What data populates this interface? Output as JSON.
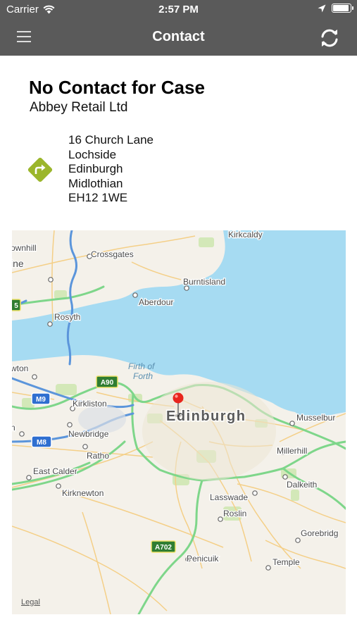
{
  "status": {
    "carrier": "Carrier",
    "time": "2:57 PM"
  },
  "nav": {
    "title": "Contact"
  },
  "contact": {
    "title": "No Contact for Case",
    "company": "Abbey Retail Ltd",
    "address": [
      "16 Church Lane",
      "Lochside",
      "Edinburgh",
      "Midlothian",
      "EH12 1WE"
    ]
  },
  "map": {
    "water_label": [
      "Firth of",
      "Forth"
    ],
    "city": "Edinburgh",
    "places": {
      "kirkcaldy": "Kirkcaldy",
      "crossgates": "Crossgates",
      "burntisland": "Burntisland",
      "aberdour": "Aberdour",
      "rosyth": "Rosyth",
      "kirkliston": "Kirkliston",
      "newbridge": "Newbridge",
      "ratho": "Ratho",
      "east_calder": "East Calder",
      "kirknewton": "Kirknewton",
      "musselburgh": "Musselbur",
      "millerhill": "Millerhill",
      "dalkeith": "Dalkeith",
      "lasswade": "Lasswade",
      "roslin": "Roslin",
      "gorebridge": "Gorebridg",
      "penicuik": "Penicuik",
      "temple": "Temple",
      "ownhill": "ownhill",
      "ine": "ine",
      "wton": "wton",
      "n_edge": "n"
    },
    "shields": {
      "a90": "A90",
      "m9": "M9",
      "m8": "M8",
      "a702": "A702",
      "left_edge": "5"
    },
    "legal": "Legal"
  },
  "colors": {
    "bar": "#5a5a5a",
    "water": "#a6dbf2",
    "motorway": "#5b95db",
    "primary": "#7ed68a",
    "pin": "#e8251d",
    "direction": "#9bb62b"
  }
}
